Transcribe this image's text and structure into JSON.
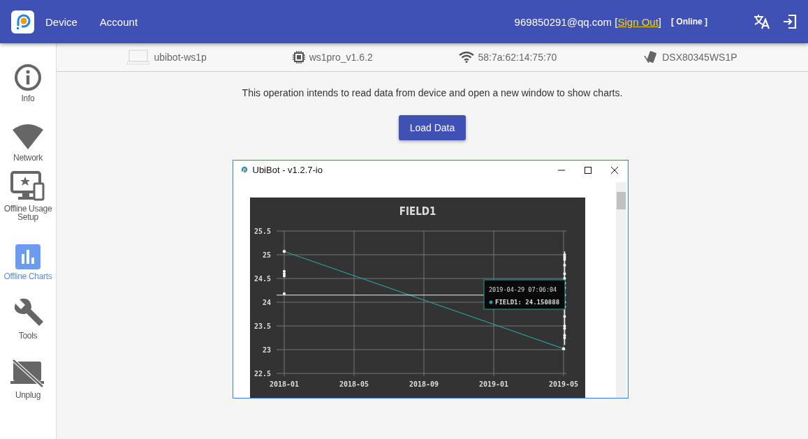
{
  "header": {
    "nav": [
      "Device",
      "Account"
    ],
    "email": "969850291@qq.com",
    "bracket_open": "[",
    "sign_out": "Sign Out",
    "bracket_close": "]",
    "status": "[ Online ]"
  },
  "sidebar": {
    "items": [
      {
        "label": "Info",
        "selected": false
      },
      {
        "label": "Network",
        "selected": false
      },
      {
        "label": "Offline Usage Setup",
        "selected": false
      },
      {
        "label": "Offline Charts",
        "selected": true
      },
      {
        "label": "Tools",
        "selected": false
      },
      {
        "label": "Unplug",
        "selected": false
      }
    ]
  },
  "device_info": [
    "ubibot-ws1p",
    "ws1pro_v1.6.2",
    "58:7a:62:14:75:70",
    "DSX80345WS1P"
  ],
  "description": "This operation intends to read data from device and open a new window to show charts.",
  "load_button": "Load Data",
  "popup": {
    "title": "UbiBot - v1.2.7-io",
    "chart": {
      "tooltip": {
        "time": "2019-04-29 07:06:04",
        "separator": ":",
        "value": "24.150888"
      },
      "chart_data": {
        "type": "line",
        "title": "FIELD1",
        "categories": [
          "2018-01",
          null,
          null,
          null,
          "2018-05",
          null,
          null,
          null,
          "2018-09",
          null,
          null,
          null,
          "2019-01",
          null,
          null,
          null,
          "2019-05"
        ],
        "series": [
          {
            "name": "FIELD1",
            "color": "#2a9d96",
            "values": [
              25.07,
              null,
              null,
              null,
              null,
              null,
              null,
              null,
              null,
              null,
              null,
              null,
              null,
              null,
              null,
              null,
              23.02
            ]
          }
        ],
        "ylim": [
          22.5,
          25.5
        ],
        "grid": true,
        "ref_lines": [
          {
            "axis": "y",
            "value": 24.15
          }
        ],
        "yticks": [
          22.5,
          23,
          23.5,
          24,
          24.5,
          25,
          25.5
        ]
      }
    }
  }
}
